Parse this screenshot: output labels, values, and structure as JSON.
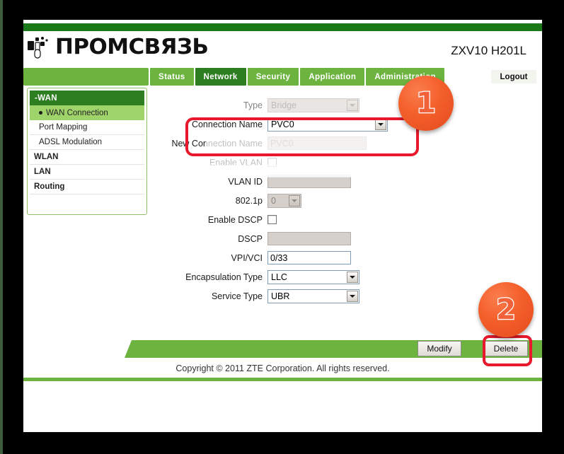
{
  "brand": {
    "logo_text": "ПРОМСВЯЗЬ",
    "logo_icon": "promsvyaz-logo-icon",
    "model": "ZXV10 H201L"
  },
  "nav": {
    "tabs": [
      {
        "label": "Status",
        "active": false
      },
      {
        "label": "Network",
        "active": true
      },
      {
        "label": "Security",
        "active": false
      },
      {
        "label": "Application",
        "active": false
      },
      {
        "label": "Administration",
        "active": false
      }
    ],
    "logout_label": "Logout"
  },
  "sidebar": {
    "header": "-WAN",
    "items": [
      {
        "label": "WAN Connection",
        "selected": true,
        "group": false
      },
      {
        "label": "Port Mapping",
        "selected": false,
        "group": false
      },
      {
        "label": "ADSL Modulation",
        "selected": false,
        "group": false
      },
      {
        "label": "WLAN",
        "selected": false,
        "group": true
      },
      {
        "label": "LAN",
        "selected": false,
        "group": true
      },
      {
        "label": "Routing",
        "selected": false,
        "group": true
      }
    ]
  },
  "form": {
    "rows": [
      {
        "label": "Type",
        "value": "Bridge",
        "kind": "select",
        "disabled": true
      },
      {
        "label": "Connection Name",
        "value": "PVC0",
        "kind": "select",
        "disabled": false
      },
      {
        "label": "New Connection Name",
        "value": "PVC0",
        "kind": "text",
        "disabled": true
      },
      {
        "label": "Enable VLAN",
        "value": "",
        "kind": "checkbox",
        "checked": false
      },
      {
        "label": "VLAN ID",
        "value": "",
        "kind": "text",
        "disabled": true
      },
      {
        "label": "802.1p",
        "value": "0",
        "kind": "select",
        "disabled": true
      },
      {
        "label": "Enable DSCP",
        "value": "",
        "kind": "checkbox",
        "checked": false
      },
      {
        "label": "DSCP",
        "value": "",
        "kind": "text",
        "disabled": true
      },
      {
        "label": "VPI/VCI",
        "value": "0/33",
        "kind": "text",
        "disabled": false
      },
      {
        "label": "Encapsulation Type",
        "value": "LLC",
        "kind": "select",
        "disabled": false
      },
      {
        "label": "Service Type",
        "value": "UBR",
        "kind": "select",
        "disabled": false
      }
    ]
  },
  "actions": {
    "modify_label": "Modify",
    "delete_label": "Delete"
  },
  "footer": {
    "copyright": "Copyright © 2011 ZTE Corporation. All rights reserved."
  },
  "annotations": {
    "badges": [
      {
        "number": "1"
      },
      {
        "number": "2"
      }
    ],
    "highlight_color": "#e8192c",
    "badge_color": "#f2623a"
  },
  "colors": {
    "green_dark": "#2d7d21",
    "green_mid": "#6cb33f",
    "green_light": "#9fd46a",
    "topbar": "#1a7a1a"
  }
}
